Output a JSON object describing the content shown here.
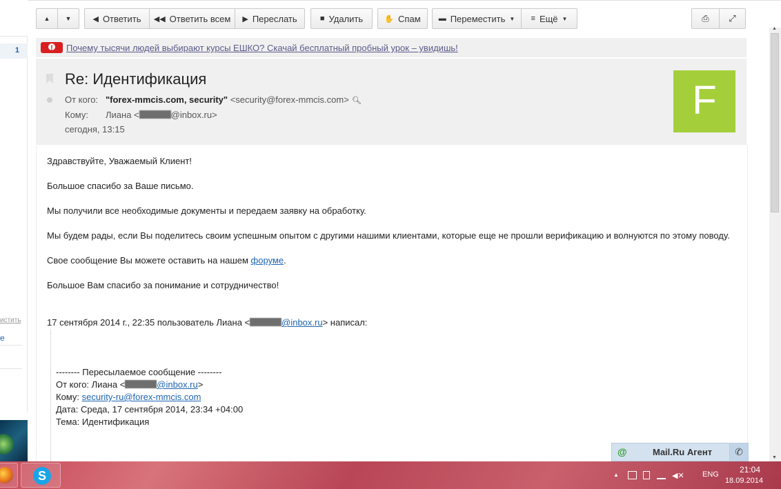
{
  "toolbar": {
    "up_icon": "arrow-up-icon",
    "down_icon": "arrow-down-icon",
    "reply": "Ответить",
    "reply_all": "Ответить всем",
    "forward": "Переслать",
    "delete": "Удалить",
    "spam": "Спам",
    "move": "Переместить",
    "more": "Ещё"
  },
  "sidebar": {
    "count": "1",
    "clear_link": "истить",
    "e_link": "е"
  },
  "banner": {
    "text": "Почему тысячи людей выбирают курсы ЕШКО? Скачай бесплатный пробный урок – увидишь!"
  },
  "message": {
    "subject": "Re: Идентификация",
    "from_label": "От кого:",
    "from_name": "\"forex-mmcis.com, security\"",
    "from_email": "<security@forex-mmcis.com>",
    "to_label": "Кому:",
    "to_name": "Лиана <",
    "to_domain": "@inbox.ru>",
    "date": "сегодня, 13:15",
    "avatar_letter": "F",
    "avatar_color": "#a4cf3a"
  },
  "body": {
    "greeting": "Здравствуйте, Уважаемый Клиент!",
    "thanks": "Большое спасибо за Ваше письмо.",
    "received": "Мы получили все необходимые документы и передаем заявку на обработку.",
    "share": "Мы будем рады, если Вы поделитесь своим успешным опытом с другими нашими клиентами, которые еще не прошли верификацию и волнуются по этому поводу.",
    "forum_prefix": "Свое сообщение Вы можете оставить на нашем ",
    "forum_link": "форуме",
    "forum_suffix": ".",
    "closing": "Большое Вам спасибо за понимание и сотрудничество!",
    "quote_header_prefix": "17 сентября 2014 г., 22:35 пользователь Лиана <",
    "quote_header_link": "@inbox.ru",
    "quote_header_suffix": "> написал:"
  },
  "quote": {
    "separator": "-------- Пересылаемое сообщение --------",
    "from_prefix": "От кого: Лиана <",
    "from_link": "@inbox.ru",
    "from_suffix": ">",
    "to_prefix": "Кому: ",
    "to_link": "security-ru@forex-mmcis.com",
    "date": "Дата: Среда, 17 сентября 2014, 23:34 +04:00",
    "subject": "Тема: Идентификация"
  },
  "agent": {
    "label": "Mail.Ru Агент"
  },
  "taskbar": {
    "skype_letter": "S",
    "lang": "ENG",
    "time": "21:04",
    "date": "18.09.2014"
  }
}
